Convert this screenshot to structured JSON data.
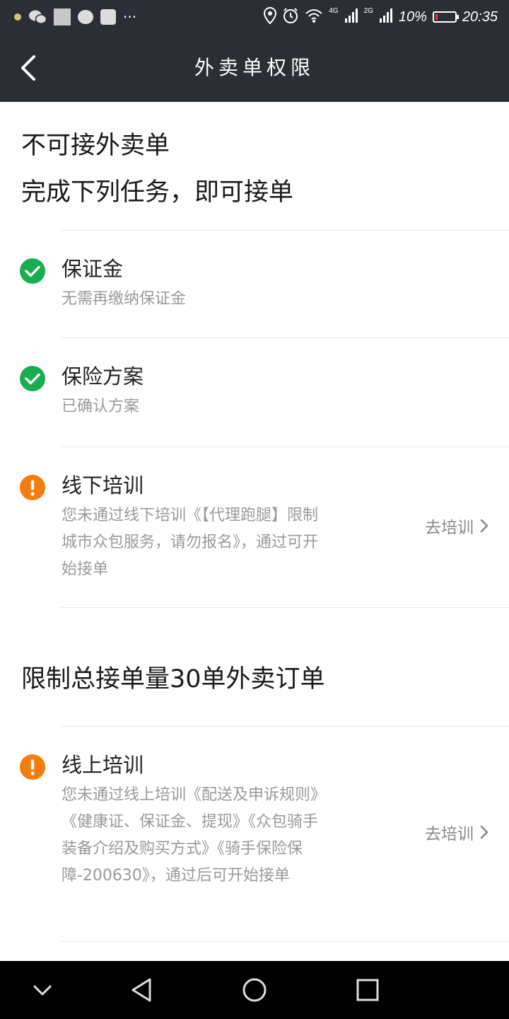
{
  "status_bar": {
    "network_4g": "4G",
    "network_2g": "2G",
    "battery_text": "10%",
    "battery_level": 0.1,
    "time": "20:35",
    "more": "···"
  },
  "header": {
    "title": "外卖单权限"
  },
  "main": {
    "heading_line1": "不可接外卖单",
    "heading_line2": "完成下列任务，即可接单",
    "tasks": [
      {
        "title": "保证金",
        "status": "done",
        "desc": "无需再缴纳保证金"
      },
      {
        "title": "保险方案",
        "status": "done",
        "desc": "已确认方案"
      },
      {
        "title": "线下培训",
        "status": "pending",
        "desc": "您未通过线下培训《【代理跑腿】限制城市众包服务，请勿报名》，通过可开始接单",
        "action": "去培训"
      }
    ],
    "limit_heading": "限制总接单量30单外卖订单",
    "limit_tasks": [
      {
        "title": "线上培训",
        "status": "pending",
        "desc": "您未通过线上培训《配送及申诉规则》《健康证、保证金、提现》《众包骑手装备介绍及购买方式》《骑手保险保障-200630》，通过后可开始接单",
        "action": "去培训"
      }
    ]
  },
  "colors": {
    "header_bg": "#2b2f35",
    "done_green": "#1aad4f",
    "warning_orange": "#f57c0f",
    "battery_red": "#e53935"
  },
  "icons": {
    "done": "check-circle-icon",
    "pending": "exclamation-circle-icon",
    "back": "chevron-left-icon",
    "action": "chevron-right-icon"
  }
}
